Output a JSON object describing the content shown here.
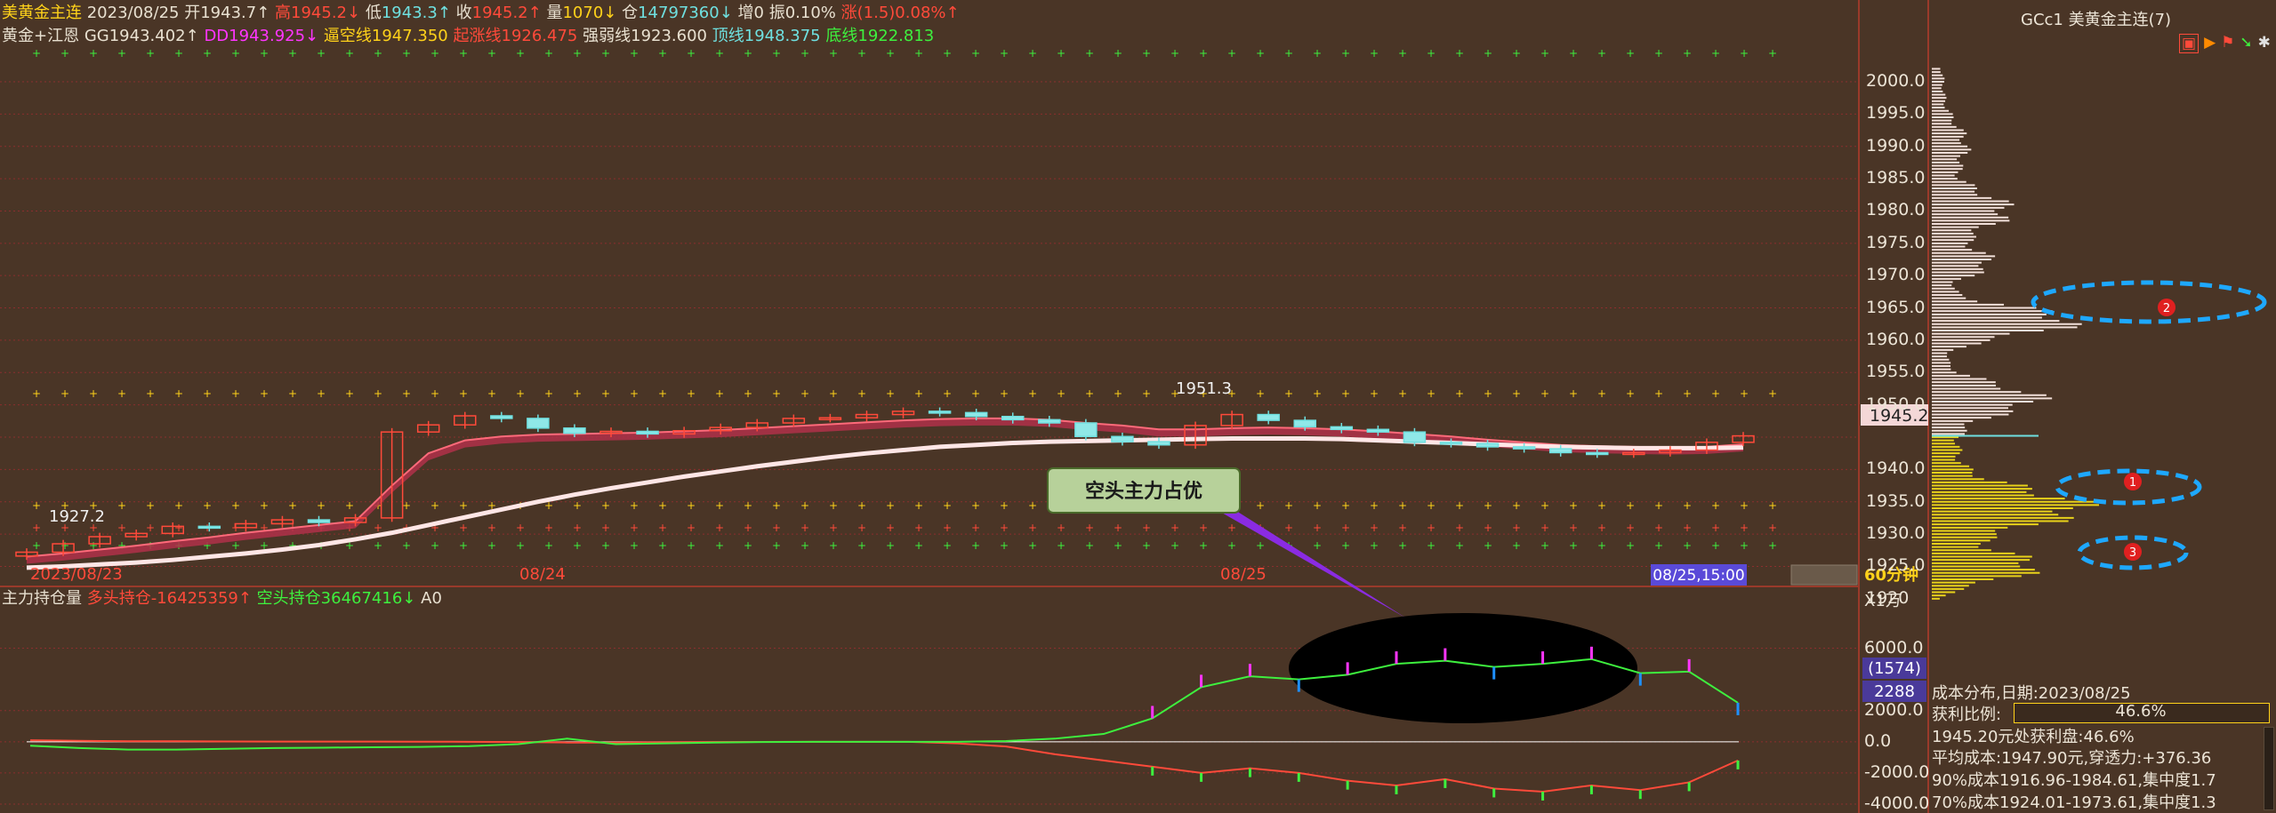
{
  "colors": {
    "bg": "#4a3526",
    "red": "#ff4a3a",
    "green": "#3ef03e",
    "cyan": "#6fe0e0",
    "yellow": "#ffd21a",
    "magenta": "#ff35ff",
    "pink": "#ffe6e6",
    "orange": "#ff8a00",
    "grid": "#7a2a2a"
  },
  "header": {
    "symbol": "美黄金主连",
    "date": "2023/08/25",
    "open_label": "开",
    "open": "1943.7↑",
    "high_label": "高",
    "high": "1945.2↓",
    "low_label": "低",
    "low": "1943.3↑",
    "close_label": "收",
    "close": "1945.2↑",
    "vol_label": "量",
    "vol": "1070↓",
    "oi_label": "仓",
    "oi": "14797360↓",
    "inc_label": "增",
    "inc": "0",
    "amp_label": "振",
    "amp": "0.10%",
    "chg_label": "涨",
    "chg": "(1.5)0.08%↑"
  },
  "indicators": {
    "name": "黄金+江恩",
    "gg_label": "GG",
    "gg": "1943.402↑",
    "dd_label": "DD",
    "dd": "1943.925↓",
    "bk_label": "逼空线",
    "bk": "1947.350",
    "qz_label": "起涨线",
    "qz": "1926.475",
    "qr_label": "强弱线",
    "qr": "1923.600",
    "top_label": "顶线",
    "top": "1948.375",
    "bot_label": "底线",
    "bot": "1922.813"
  },
  "lower_header": {
    "title": "主力持仓量",
    "long_label": "多头持仓",
    "long": "-16425359↑",
    "short_label": "空头持仓",
    "short": "36467416↓",
    "a_label": "A",
    "a": "0"
  },
  "price_axis": {
    "ticks": [
      "2000.0",
      "1995.0",
      "1990.0",
      "1985.0",
      "1980.0",
      "1975.0",
      "1970.0",
      "1965.0",
      "1960.0",
      "1955.0",
      "1950.0",
      "1945.2",
      "1940.0",
      "1935.0",
      "1930.0",
      "1925.0",
      "1920"
    ],
    "current": "1945.2"
  },
  "date_axis": {
    "labels": [
      "2023/08/23",
      "08/24",
      "08/25"
    ],
    "cursor": "08/25,15:00",
    "period": "60分钟"
  },
  "lower_axis": {
    "unit": "X1万",
    "ticks": [
      "6000.0",
      "2000.0",
      "0.0",
      "-2000.0",
      "-4000.0"
    ],
    "badge1": "(1574)",
    "badge2": "2288"
  },
  "chart_labels": {
    "hi": "1951.3",
    "lo": "1927.2",
    "callout": "空头主力占优"
  },
  "right_panel": {
    "title": "GCc1 美黄金主连(7)",
    "cost_dist": "成本分布,日期:2023/08/25",
    "profit_ratio_label": "获利比例:",
    "profit_ratio": "46.6%",
    "profit_line": "1945.20元处获利盘:46.6%",
    "avg_cost": "平均成本:1947.90元,穿透力:+376.36",
    "c90": "90%成本1916.96-1984.61,集中度1.7",
    "c70": "70%成本1924.01-1973.61,集中度1.3",
    "markers": [
      "1",
      "2",
      "3"
    ]
  },
  "chart_data": [
    {
      "type": "candlestick",
      "x": [
        "2023/08/23",
        "08/24",
        "08/25"
      ],
      "ylim": [
        1920,
        2003
      ],
      "series": [
        {
          "values": [
            1927.2,
            1928.5,
            1929.6,
            1930.1,
            1931.2,
            1931.0,
            1931.6,
            1932.2,
            1931.8,
            1932.5,
            1945.8,
            1946.9,
            1948.3,
            1947.9,
            1946.4,
            1945.6,
            1945.9,
            1945.5,
            1946.0,
            1946.5,
            1947.2,
            1947.9,
            1948.0,
            1948.5,
            1949.0,
            1948.8,
            1948.2,
            1947.7,
            1947.2,
            1945.1,
            1944.3,
            1943.8,
            1946.8,
            1948.5,
            1947.6,
            1946.6,
            1946.2,
            1945.8,
            1944.2,
            1944.0,
            1943.5,
            1943.2,
            1942.6,
            1942.4,
            1942.6,
            1943.0,
            1944.2,
            1945.2
          ]
        },
        {
          "values": [
            1926.5,
            1927.0,
            1927.6,
            1928.2,
            1928.9,
            1929.5,
            1930.2,
            1930.8,
            1931.4,
            1932.0,
            1937.5,
            1942.5,
            1944.5,
            1945.1,
            1945.4,
            1945.5,
            1945.6,
            1945.7,
            1945.9,
            1946.1,
            1946.4,
            1946.7,
            1947.0,
            1947.3,
            1947.6,
            1947.8,
            1947.9,
            1947.9,
            1947.7,
            1947.2,
            1946.8,
            1946.2,
            1946.2,
            1946.4,
            1946.5,
            1946.4,
            1946.2,
            1945.9,
            1945.5,
            1945.1,
            1944.6,
            1944.2,
            1943.8,
            1943.6,
            1943.5,
            1943.4,
            1943.5,
            1943.9
          ]
        },
        {
          "values": [
            1924.8,
            1925.0,
            1925.3,
            1925.6,
            1926.0,
            1926.5,
            1927.0,
            1927.6,
            1928.3,
            1929.2,
            1930.2,
            1931.4,
            1932.6,
            1933.8,
            1935.0,
            1936.1,
            1937.1,
            1938.0,
            1938.9,
            1939.7,
            1940.5,
            1941.2,
            1941.9,
            1942.5,
            1943.0,
            1943.5,
            1943.8,
            1944.1,
            1944.3,
            1944.4,
            1944.5,
            1944.6,
            1944.7,
            1944.8,
            1944.8,
            1944.8,
            1944.7,
            1944.5,
            1944.3,
            1944.1,
            1943.9,
            1943.7,
            1943.5,
            1943.4,
            1943.3,
            1943.3,
            1943.3,
            1943.4
          ]
        }
      ]
    },
    {
      "type": "line",
      "name": "主力持仓量",
      "ylim": [
        -4000,
        7000
      ],
      "series": [
        {
          "values": [
            -250,
            -400,
            -500,
            -500,
            -450,
            -400,
            -380,
            -350,
            -330,
            -280,
            -150,
            200,
            -150,
            -100,
            -50,
            -20,
            0,
            0,
            0,
            0,
            50,
            200,
            500,
            1500,
            3500,
            4200,
            4000,
            4300,
            5000,
            5200,
            4800,
            5000,
            5300,
            4400,
            4500,
            2500
          ]
        },
        {
          "values": [
            100,
            60,
            30,
            30,
            20,
            10,
            10,
            10,
            5,
            0,
            -20,
            -50,
            -50,
            -30,
            -20,
            -10,
            0,
            0,
            0,
            -100,
            -300,
            -800,
            -1200,
            -1600,
            -2000,
            -1700,
            -2000,
            -2500,
            -2800,
            -2400,
            -3000,
            -3200,
            -2800,
            -3100,
            -2600,
            -1200
          ]
        }
      ]
    }
  ]
}
